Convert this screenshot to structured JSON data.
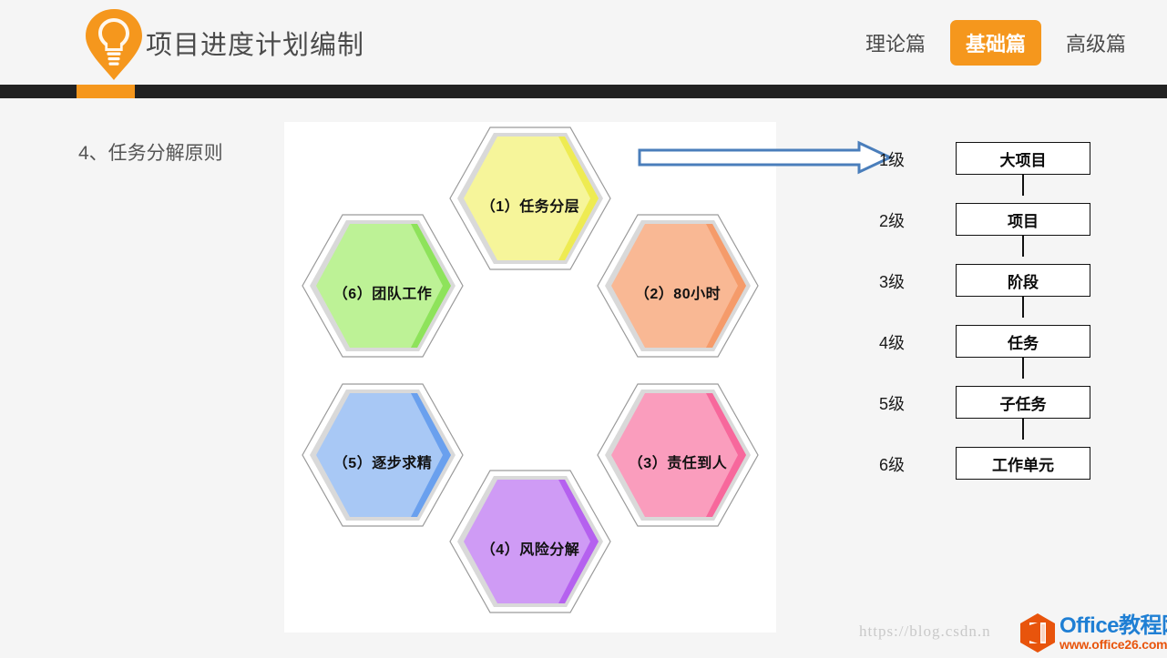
{
  "header": {
    "logo_icon": "lightbulb-pin-icon",
    "title": "项目进度计划编制",
    "nav": [
      {
        "label": "理论篇",
        "active": false
      },
      {
        "label": "基础篇",
        "active": true
      },
      {
        "label": "高级篇",
        "active": false
      }
    ],
    "accent_color": "#f5971d",
    "bar_color": "#222222"
  },
  "main": {
    "section_title": "4、任务分解原则",
    "arrow_icon": "right-block-arrow-icon",
    "arrow_color": "#4a7ebb",
    "hexagons": [
      {
        "id": 1,
        "label": "（1）任务分层",
        "fill": "#f6f59a",
        "edge": "#eeeb52"
      },
      {
        "id": 2,
        "label": "（2）80小时",
        "fill": "#f9b894",
        "edge": "#f59b6a"
      },
      {
        "id": 3,
        "label": "（3）责任到人",
        "fill": "#fa9dbd",
        "edge": "#f7689c"
      },
      {
        "id": 4,
        "label": "（4）风险分解",
        "fill": "#cf9bf5",
        "edge": "#b561ef"
      },
      {
        "id": 5,
        "label": "（5）逐步求精",
        "fill": "#a8c8f5",
        "edge": "#6aa0ee"
      },
      {
        "id": 6,
        "label": "（6）团队工作",
        "fill": "#bdf296",
        "edge": "#8ee35b"
      }
    ],
    "levels": [
      {
        "tag": "1级",
        "name": "大项目"
      },
      {
        "tag": "2级",
        "name": "项目"
      },
      {
        "tag": "3级",
        "name": "阶段"
      },
      {
        "tag": "4级",
        "name": "任务"
      },
      {
        "tag": "5级",
        "name": "子任务"
      },
      {
        "tag": "6级",
        "name": "工作单元"
      }
    ]
  },
  "watermarks": {
    "csdn": "https://blog.csdn.n",
    "office_name": "Office教程网",
    "office_url": "www.office26.com",
    "office_icon": "office-hex-logo-icon"
  }
}
